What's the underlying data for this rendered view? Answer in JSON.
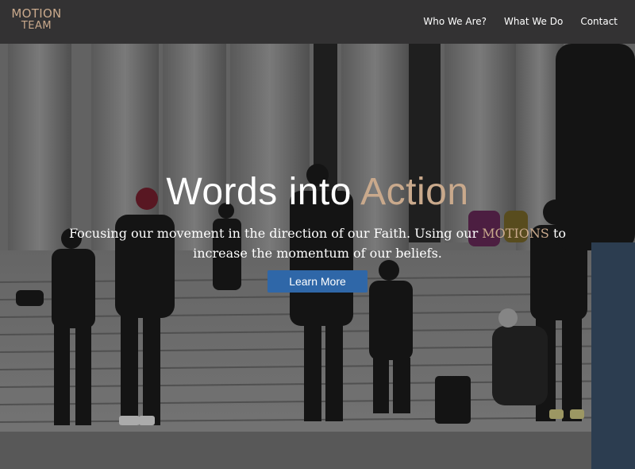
{
  "brand": {
    "line1": "MOTION",
    "line2": "TEAM"
  },
  "nav": [
    {
      "label": "Who We Are?"
    },
    {
      "label": "What We Do"
    },
    {
      "label": "Contact"
    }
  ],
  "hero": {
    "title_main": "Words into ",
    "title_accent": "Action",
    "subtitle_part1": "Focusing our movement in the direction of our Faith. Using our ",
    "subtitle_accent": "MOTIONS",
    "subtitle_part2": " to increase the momentum of our beliefs.",
    "cta_label": "Learn More"
  },
  "colors": {
    "navbar": "#333233",
    "brand_accent": "#c9a98c",
    "cta": "#2f67a8"
  }
}
